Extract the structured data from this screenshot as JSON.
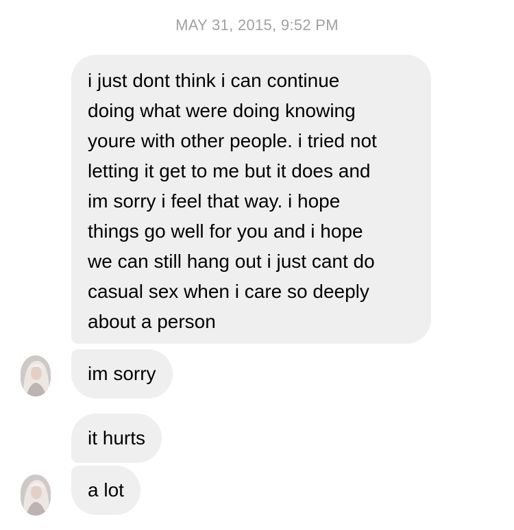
{
  "conversation": {
    "timestamp": "MAY 31, 2015, 9:52 PM",
    "messages": [
      {
        "lines": [
          "i just dont think i can continue",
          "doing what were doing knowing",
          "youre with other people. i tried not",
          "letting it get to me but it does and",
          "im sorry i feel that way. i hope",
          "things go well for you and i hope",
          "we can still hang out i just cant do",
          "casual sex when i care so deeply",
          "about a person"
        ]
      },
      {
        "text": "im sorry"
      },
      {
        "text": "it hurts"
      },
      {
        "text": "a lot"
      }
    ]
  },
  "colors": {
    "bubble_background": "#efefef",
    "timestamp_text": "#a0a0a5",
    "message_text": "#000000"
  },
  "icons": {
    "sender_avatar": "profile-photo-avatar"
  }
}
